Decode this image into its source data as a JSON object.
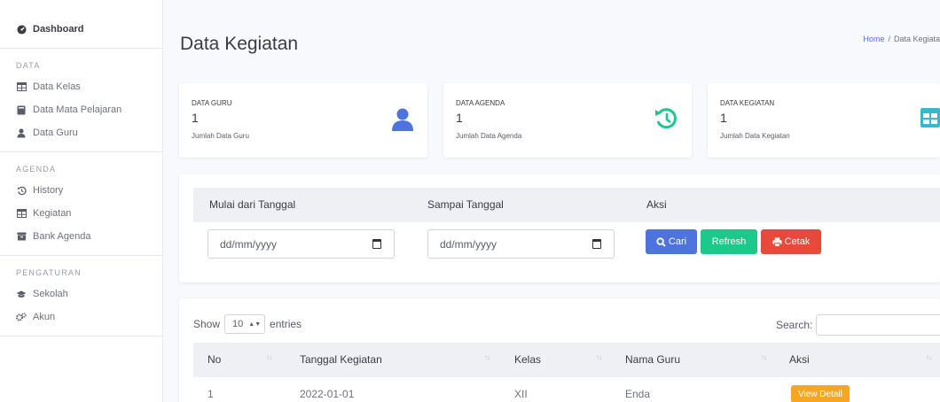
{
  "sidebar": {
    "dashboard": "Dashboard",
    "sections": [
      {
        "heading": "DATA",
        "items": [
          {
            "label": "Data Kelas",
            "icon": "table-icon"
          },
          {
            "label": "Data Mata Pelajaran",
            "icon": "book-icon"
          },
          {
            "label": "Data Guru",
            "icon": "user-icon"
          }
        ]
      },
      {
        "heading": "AGENDA",
        "items": [
          {
            "label": "History",
            "icon": "history-icon"
          },
          {
            "label": "Kegiatan",
            "icon": "table-icon"
          },
          {
            "label": "Bank Agenda",
            "icon": "archive-icon"
          }
        ]
      },
      {
        "heading": "PENGATURAN",
        "items": [
          {
            "label": "Sekolah",
            "icon": "graduation-cap-icon"
          },
          {
            "label": "Akun",
            "icon": "cogs-icon"
          }
        ]
      }
    ]
  },
  "page": {
    "title": "Data Kegiatan",
    "breadcrumb_home": "Home",
    "breadcrumb_sep": "/",
    "breadcrumb_current": "Data Kegiata"
  },
  "stats": [
    {
      "label": "DATA GURU",
      "value": "1",
      "sub": "Jumlah Data Guru",
      "icon": "user-icon",
      "color": "#4e73df"
    },
    {
      "label": "DATA AGENDA",
      "value": "1",
      "sub": "Jumlah Data Agenda",
      "icon": "history-icon",
      "color": "#1cc88a"
    },
    {
      "label": "DATA KEGIATAN",
      "value": "1",
      "sub": "Jumlah Data Kegiatan",
      "icon": "table-icon",
      "color": "#36b9cc"
    }
  ],
  "filter": {
    "col1": "Mulai dari Tanggal",
    "col2": "Sampai Tanggal",
    "col3": "Aksi",
    "date_placeholder": "dd/mm/yyyy",
    "btn_cari": "Cari",
    "btn_refresh": "Refresh",
    "btn_cetak": "Cetak",
    "colors": {
      "cari": "#4e73df",
      "refresh": "#1cc88a",
      "cetak": "#e74a3b"
    }
  },
  "table": {
    "show_label": "Show",
    "entries_value": "10",
    "entries_label": "entries",
    "search_label": "Search:",
    "headers": [
      "No",
      "Tanggal Kegiatan",
      "Kelas",
      "Nama Guru",
      "Aksi"
    ],
    "rows": [
      {
        "no": "1",
        "tanggal": "2022-01-01",
        "kelas": "XII",
        "guru": "Enda",
        "aksi": "View Detail"
      }
    ]
  }
}
